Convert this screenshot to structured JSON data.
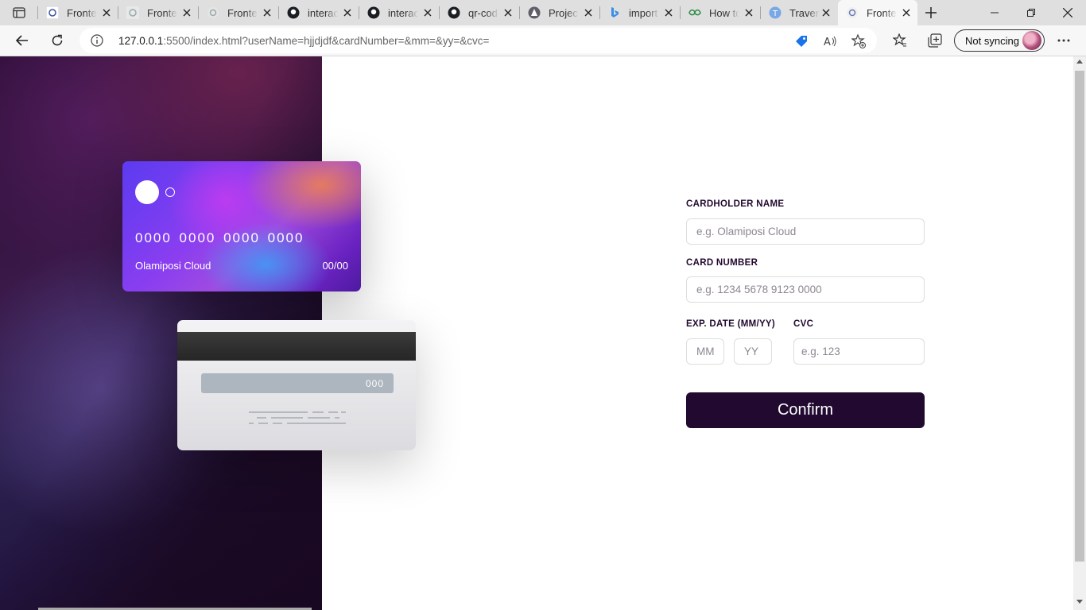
{
  "browser": {
    "tabs": [
      {
        "title": "Frontend Mentor",
        "icon": "frontendmentor-icon",
        "active": false
      },
      {
        "title": "Frontend Mentor",
        "icon": "frontendmentor-icon",
        "active": false
      },
      {
        "title": "Frontend Mentor",
        "icon": "frontendmentor-icon",
        "active": false
      },
      {
        "title": "interactive",
        "icon": "github-icon",
        "active": false
      },
      {
        "title": "interactive",
        "icon": "github-icon",
        "active": false
      },
      {
        "title": "qr-code",
        "icon": "github-icon",
        "active": false
      },
      {
        "title": "Projects",
        "icon": "project-icon",
        "active": false
      },
      {
        "title": "import",
        "icon": "bing-icon",
        "active": false
      },
      {
        "title": "How to",
        "icon": "geeks-icon",
        "active": false
      },
      {
        "title": "Traversy",
        "icon": "traversy-icon",
        "active": false
      },
      {
        "title": "Frontend Mentor",
        "icon": "frontendmentor-icon",
        "active": true
      }
    ],
    "url_host": "127.0.0.1",
    "url_rest": ":5500/index.html?userName=hjjdjdf&cardNumber=&mm=&yy=&cvc=",
    "sync_label": "Not syncing"
  },
  "card_front": {
    "number": "0000 0000 0000 0000",
    "name": "Olamiposi Cloud",
    "expiry": "00/00"
  },
  "card_back": {
    "cvc": "000"
  },
  "form": {
    "cardholder_label": "CARDHOLDER NAME",
    "cardholder_placeholder": "e.g. Olamiposi Cloud",
    "number_label": "CARD NUMBER",
    "number_placeholder": "e.g. 1234 5678 9123 0000",
    "exp_label": "EXP. DATE (MM/YY)",
    "mm_placeholder": "MM",
    "yy_placeholder": "YY",
    "cvc_label": "CVC",
    "cvc_placeholder": "e.g. 123",
    "confirm_label": "Confirm"
  },
  "colors": {
    "accent_dark": "#21092f",
    "border": "#dedddf",
    "placeholder": "#8e8593"
  }
}
